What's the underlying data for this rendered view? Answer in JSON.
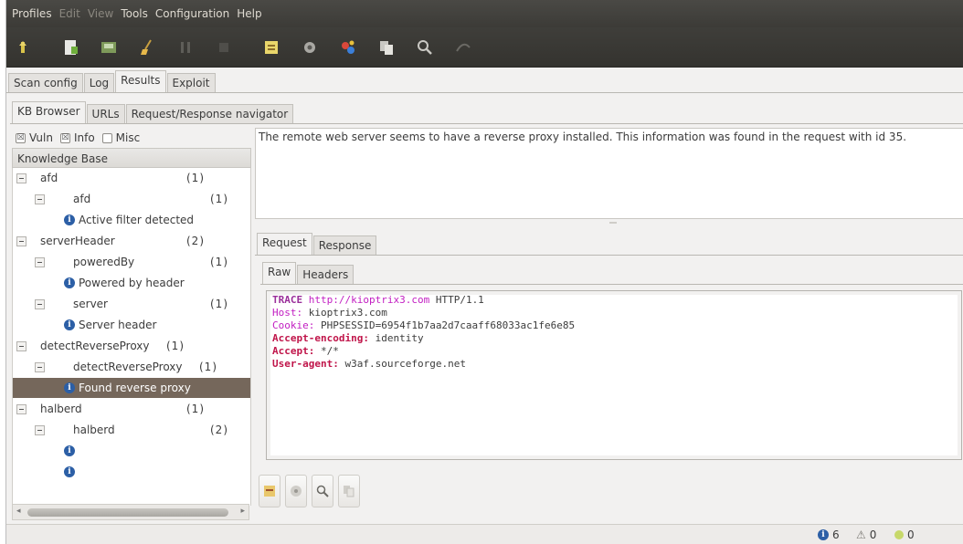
{
  "menubar": [
    "Profiles",
    "Edit",
    "View",
    "Tools",
    "Configuration",
    "Help"
  ],
  "toolbar": [
    "start-icon",
    "new-profile-icon",
    "save-profile-icon",
    "clear-icon",
    "pause-icon",
    "stop-icon",
    "manual-request-icon",
    "fuzzy-request-icon",
    "encode-decode-icon",
    "export-request-icon",
    "compare-icon",
    "proxy-icon"
  ],
  "main_tabs": [
    "Scan config",
    "Log",
    "Results",
    "Exploit"
  ],
  "results_tabs": [
    "KB Browser",
    "URLs",
    "Request/Response navigator"
  ],
  "filters": [
    {
      "label": "Vuln",
      "checked": true
    },
    {
      "label": "Info",
      "checked": true
    },
    {
      "label": "Misc",
      "checked": false
    }
  ],
  "kb": {
    "header": "Knowledge Base",
    "rows": [
      {
        "label": "afd",
        "count": "(1)"
      },
      {
        "label": "afd",
        "count": "(1)"
      },
      {
        "label": "Active filter detected",
        "count": ""
      },
      {
        "label": "serverHeader",
        "count": "(2)"
      },
      {
        "label": "poweredBy",
        "count": "(1)"
      },
      {
        "label": "Powered by header",
        "count": ""
      },
      {
        "label": "server",
        "count": "(1)"
      },
      {
        "label": "Server header",
        "count": ""
      },
      {
        "label": "detectReverseProxy",
        "count": "(1)"
      },
      {
        "label": "detectReverseProxy",
        "count": "(1)"
      },
      {
        "label": "Found reverse proxy",
        "count": ""
      },
      {
        "label": "halberd",
        "count": "(1)"
      },
      {
        "label": "halberd",
        "count": "(2)"
      },
      {
        "label": "",
        "count": ""
      },
      {
        "label": "",
        "count": ""
      }
    ]
  },
  "description": "The remote web server seems to have a reverse proxy installed. This information was found in the request with id 35.",
  "detail_tabs": [
    "Request",
    "Response"
  ],
  "view_tabs": [
    "Raw",
    "Headers"
  ],
  "request": {
    "method": "TRACE",
    "url": "http://kioptrix3.com",
    "version": "HTTP/1.1",
    "headers": [
      {
        "name": "Host:",
        "value": "kioptrix3.com"
      },
      {
        "name": "Cookie:",
        "value": "PHPSESSID=6954f1b7aa2d7caaff68033ac1fe6e85"
      },
      {
        "name": "Accept-encoding:",
        "value": "identity"
      },
      {
        "name": "Accept:",
        "value": "*/*"
      },
      {
        "name": "User-agent:",
        "value": "w3af.sourceforge.net"
      }
    ]
  },
  "bottom_buttons": [
    "send-to-manual-request-icon",
    "send-to-fuzzy-icon",
    "search-icon",
    "send-to-compare-icon"
  ],
  "status": {
    "info": "6",
    "warning": "0",
    "vuln": "0"
  },
  "colors": {
    "selected_row": "#75675b",
    "info_icon": "#2c5fa6",
    "header_name": "#c21ec2",
    "header_bold": "#c0154a"
  }
}
